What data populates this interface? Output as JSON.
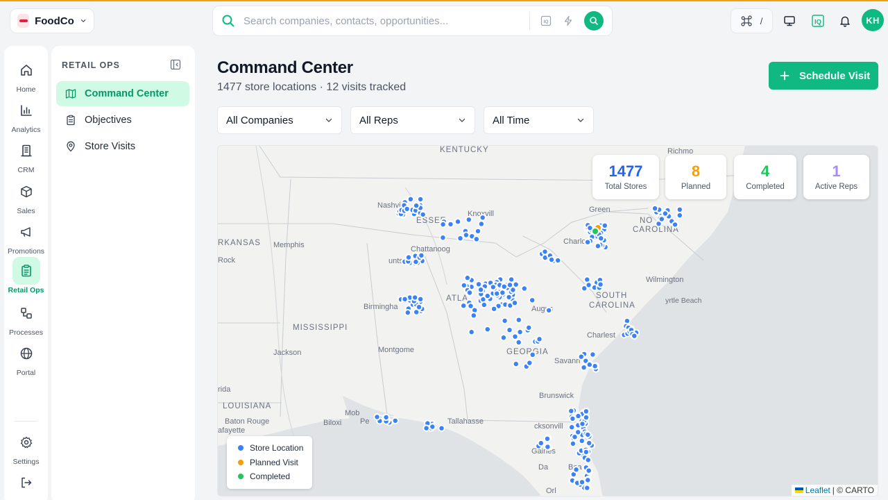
{
  "org": {
    "name": "FoodCo"
  },
  "search": {
    "placeholder": "Search companies, contacts, opportunities..."
  },
  "header": {
    "shortcut_key": "/",
    "avatar_initials": "KH",
    "iq_icon": "IQ"
  },
  "rail": {
    "items": [
      {
        "label": "Home",
        "icon": "home-icon"
      },
      {
        "label": "Analytics",
        "icon": "bar-chart-icon"
      },
      {
        "label": "CRM",
        "icon": "building-icon"
      },
      {
        "label": "Sales",
        "icon": "box-icon"
      },
      {
        "label": "Promotions",
        "icon": "megaphone-icon"
      },
      {
        "label": "Retail Ops",
        "icon": "clipboard-icon",
        "active": true
      },
      {
        "label": "Processes",
        "icon": "workflow-icon"
      },
      {
        "label": "Portal",
        "icon": "globe-icon"
      }
    ],
    "settings_label": "Settings"
  },
  "subnav": {
    "title": "RETAIL OPS",
    "items": [
      {
        "label": "Command Center",
        "icon": "map-icon",
        "active": true
      },
      {
        "label": "Objectives",
        "icon": "clipboard-list-icon"
      },
      {
        "label": "Store Visits",
        "icon": "map-pin-icon"
      }
    ]
  },
  "page": {
    "title": "Command Center",
    "subtitle": "1477 store locations · 12 visits tracked",
    "cta_label": "Schedule Visit"
  },
  "filters": [
    {
      "label": "All Companies"
    },
    {
      "label": "All Reps"
    },
    {
      "label": "All Time"
    }
  ],
  "stats": [
    {
      "value": "1477",
      "label": "Total Stores",
      "color": "#2563eb"
    },
    {
      "value": "8",
      "label": "Planned",
      "color": "#f59e0b"
    },
    {
      "value": "4",
      "label": "Completed",
      "color": "#22c55e"
    },
    {
      "value": "1",
      "label": "Active Reps",
      "color": "#a78bfa"
    }
  ],
  "legend": [
    {
      "label": "Store Location",
      "color": "#3b82f6"
    },
    {
      "label": "Planned Visit",
      "color": "#f59e0b"
    },
    {
      "label": "Completed",
      "color": "#22c55e"
    }
  ],
  "map": {
    "labels": {
      "kentucky": "KENTUCKY",
      "richmond": "Richmo",
      "nashville": "Nashvill",
      "tennessee": "ESSEE",
      "knoxville": "Knoxvill",
      "greensboro": "Green",
      "north_carolina_1": "NO",
      "north_carolina_2": "CAROLINA",
      "arkansas": "RKANSAS",
      "memphis": "Memphis",
      "rock": "Rock",
      "chattanooga": "Chattanoog",
      "charlotte": "Charlo",
      "huntsville": "unts",
      "wilmington": "Wilmington",
      "atlanta": "ATLA",
      "birmingham": "Birmingha",
      "augusta": "Augus",
      "south_carolina_1": "SOUTH",
      "south_carolina_2": "CAROLINA",
      "myrtle_beach": "yrtle Beach",
      "mississippi": "MISSISSIPPI",
      "charleston": "Charlest",
      "jackson": "Jackson",
      "montgomery": "Montgome",
      "georgia": "GEORGIA",
      "savannah": "Savann",
      "rida": "rida",
      "brunswick": "Brunswick",
      "louisiana": "LOUISIANA",
      "mobile": "Mob",
      "pensacola": "Pe",
      "tallahassee": "Tallahasse",
      "jacksonville": "cksonvill",
      "baton_rouge": "Baton Rouge",
      "biloxi": "Biloxi",
      "lafayette": "afayette",
      "gainesville": "Gaines",
      "daytona": "Da",
      "daytona_beach": "Bea",
      "orlando": "Orl"
    },
    "attribution": {
      "leaflet": "Leaflet",
      "separator": " | © CARTO"
    }
  }
}
